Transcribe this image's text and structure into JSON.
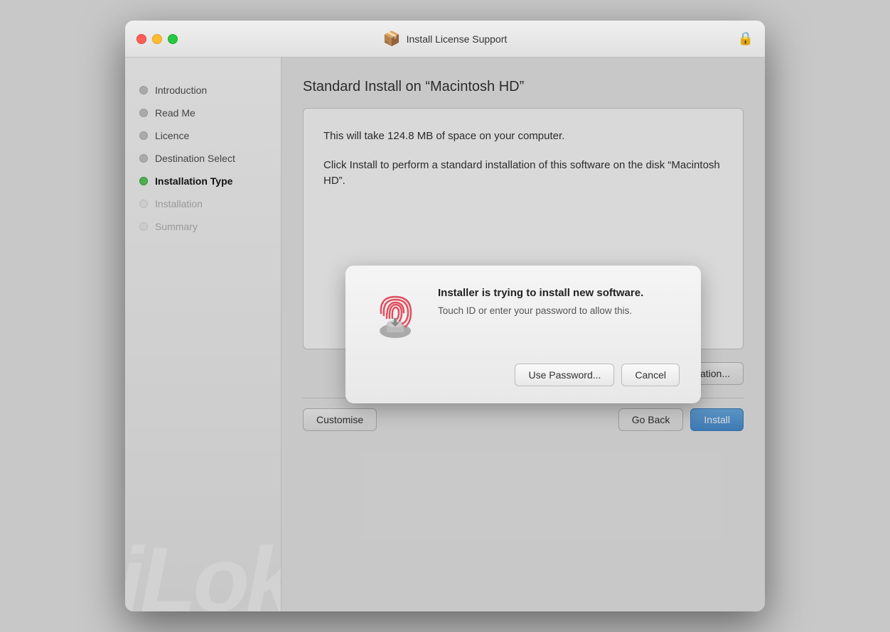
{
  "window": {
    "title": "Install License Support",
    "icon": "📦"
  },
  "sidebar": {
    "items": [
      {
        "id": "introduction",
        "label": "Introduction",
        "state": "inactive"
      },
      {
        "id": "read-me",
        "label": "Read Me",
        "state": "inactive"
      },
      {
        "id": "licence",
        "label": "Licence",
        "state": "inactive"
      },
      {
        "id": "destination-select",
        "label": "Destination Select",
        "state": "inactive"
      },
      {
        "id": "installation-type",
        "label": "Installation Type",
        "state": "active"
      },
      {
        "id": "installation",
        "label": "Installation",
        "state": "dim"
      },
      {
        "id": "summary",
        "label": "Summary",
        "state": "dim"
      }
    ],
    "watermark": "iLok"
  },
  "main": {
    "title": "Standard Install on “Macintosh HD”",
    "install_box": {
      "line1": "This will take 124.8 MB of space on your computer.",
      "line2": "Click Install to perform a standard installation of this software on the disk “Macintosh HD”."
    },
    "change_location_button": "Change Install Location...",
    "buttons": {
      "customise": "Customise",
      "go_back": "Go Back",
      "install": "Install"
    }
  },
  "dialog": {
    "title": "Installer is trying to install new software.",
    "subtitle": "Touch ID or enter your password to allow this.",
    "use_password_button": "Use Password...",
    "cancel_button": "Cancel"
  },
  "icons": {
    "lock": "🔒",
    "close": "✕",
    "minimize": "−",
    "maximize": "+"
  }
}
